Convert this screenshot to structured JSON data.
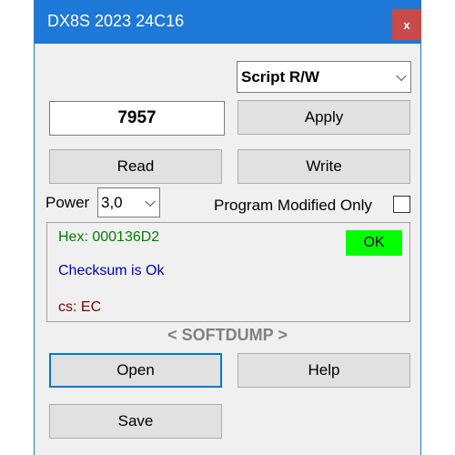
{
  "window": {
    "title": "DX8S 2023 24C16",
    "close_label": "x"
  },
  "mode_select": {
    "value": "Script R/W"
  },
  "value_display": "7957",
  "buttons": {
    "apply": "Apply",
    "read": "Read",
    "write": "Write",
    "open": "Open",
    "help": "Help",
    "save": "Save"
  },
  "power": {
    "label": "Power",
    "value": "3,0"
  },
  "program_modified": {
    "label": "Program Modified Only",
    "checked": false
  },
  "status": {
    "hex": "Hex: 000136D2",
    "checksum": "Checksum is Ok",
    "cs": "cs: EC",
    "badge": "OK",
    "colors": {
      "hex": "#008000",
      "checksum": "#0000c0",
      "cs": "#800000",
      "badge_bg": "#00ff00"
    }
  },
  "brand": "< SOFTDUMP >",
  "colors": {
    "titlebar": "#1e78d7",
    "close": "#c84a4a"
  }
}
